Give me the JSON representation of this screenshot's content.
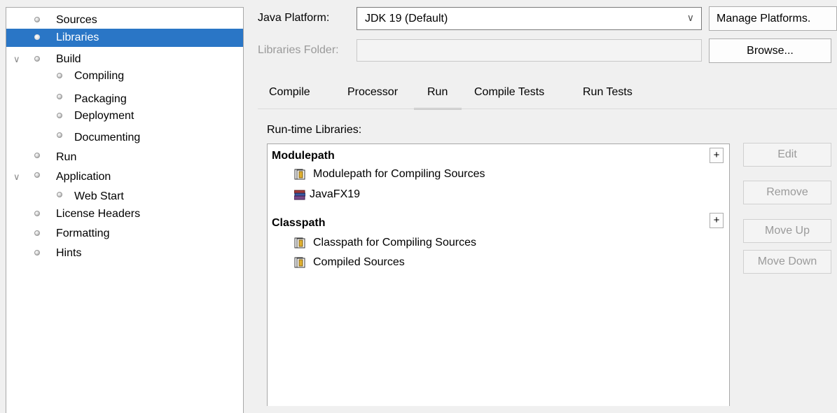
{
  "tree": {
    "items": [
      {
        "label": "Sources"
      },
      {
        "label": "Libraries"
      },
      {
        "label": "Build"
      },
      {
        "label": "Compiling"
      },
      {
        "label": "Packaging"
      },
      {
        "label": "Deployment"
      },
      {
        "label": "Documenting"
      },
      {
        "label": "Run"
      },
      {
        "label": "Application"
      },
      {
        "label": "Web Start"
      },
      {
        "label": "License Headers"
      },
      {
        "label": "Formatting"
      },
      {
        "label": "Hints"
      }
    ],
    "selected": "Libraries"
  },
  "platform": {
    "label": "Java Platform:",
    "value": "JDK 19 (Default)",
    "manage_button": "Manage Platforms."
  },
  "libraries_folder": {
    "label": "Libraries Folder:",
    "value": "",
    "browse_button": "Browse..."
  },
  "tabs": [
    {
      "label": "Compile"
    },
    {
      "label": "Processor"
    },
    {
      "label": "Run"
    },
    {
      "label": "Compile Tests"
    },
    {
      "label": "Run Tests"
    }
  ],
  "active_tab": "Run",
  "runtime": {
    "heading": "Run-time Libraries:",
    "modulepath": {
      "header": "Modulepath",
      "add_label": "+",
      "items": [
        "Modulepath for Compiling Sources",
        "JavaFX19"
      ]
    },
    "classpath": {
      "header": "Classpath",
      "add_label": "+",
      "items": [
        "Classpath for Compiling Sources",
        "Compiled Sources"
      ]
    }
  },
  "actions": {
    "edit": "Edit",
    "remove": "Remove",
    "move_up": "Move Up",
    "move_down": "Move Down"
  },
  "colors": {
    "selection": "#2a76c6",
    "disabled_text": "#9a9a9a"
  }
}
